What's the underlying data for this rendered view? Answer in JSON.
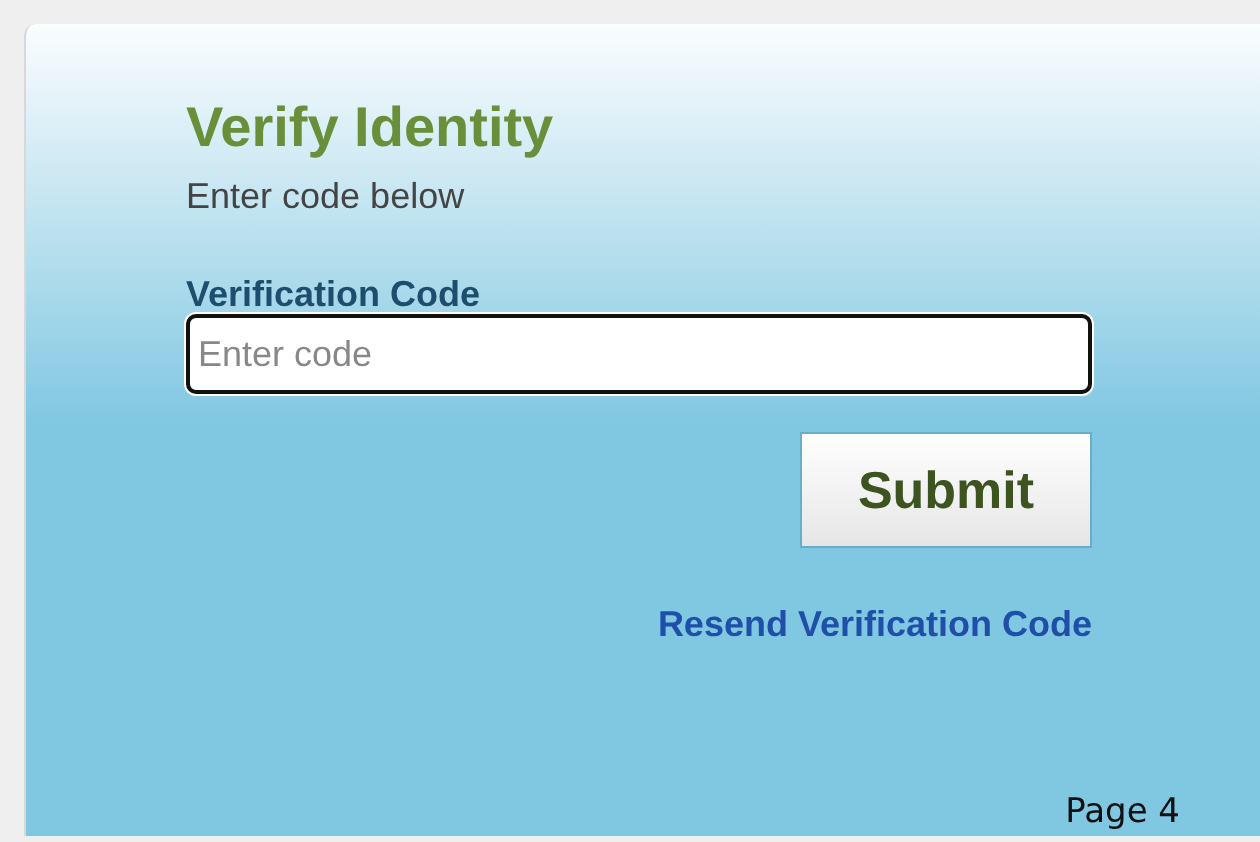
{
  "form": {
    "title": "Verify Identity",
    "subtitle": "Enter code below",
    "field": {
      "label": "Verification Code",
      "placeholder": "Enter code",
      "focused": true
    },
    "submit": "Submit",
    "resend_link": "Resend Verification Code"
  },
  "footer": {
    "page": "Page 4"
  }
}
